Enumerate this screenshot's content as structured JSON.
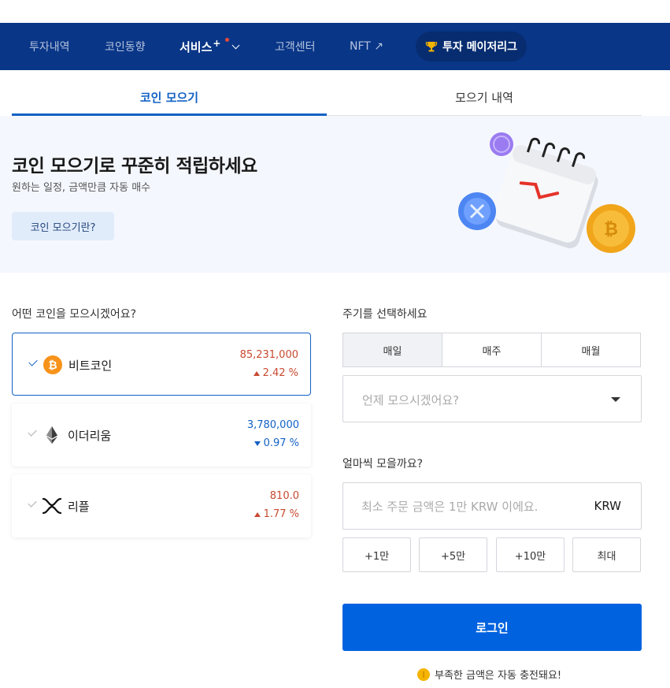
{
  "nav": {
    "items": [
      {
        "label": "투자내역"
      },
      {
        "label": "코인동향"
      },
      {
        "label": "서비스",
        "sup": "+"
      },
      {
        "label": "고객센터"
      },
      {
        "label": "NFT ↗"
      }
    ],
    "league": "투자 메이저리그"
  },
  "tabs": [
    {
      "label": "코인 모으기",
      "active": true
    },
    {
      "label": "모으기 내역",
      "active": false
    }
  ],
  "hero": {
    "title": "코인 모으기로 꾸준히 적립하세요",
    "subtitle": "원하는 일정, 금액만큼 자동 매수",
    "button": "코인 모으기란?"
  },
  "coin_section": {
    "question": "어떤 코인을 모으시겠어요?",
    "coins": [
      {
        "name": "비트코인",
        "price": "85,231,000",
        "change": "2.42 %",
        "direction": "up",
        "selected": true,
        "icon": "bitcoin-icon"
      },
      {
        "name": "이더리움",
        "price": "3,780,000",
        "change": "0.97 %",
        "direction": "down",
        "selected": false,
        "icon": "ethereum-icon"
      },
      {
        "name": "리플",
        "price": "810.0",
        "change": "1.77 %",
        "direction": "up",
        "selected": false,
        "icon": "xrp-icon"
      }
    ]
  },
  "period_section": {
    "question": "주기를 선택하세요",
    "options": [
      "매일",
      "매주",
      "매월"
    ],
    "selected": "매일",
    "select_placeholder": "언제 모으시겠어요?"
  },
  "amount_section": {
    "question": "얼마씩 모을까요?",
    "placeholder": "최소 주문 금액은 1만 KRW 이에요.",
    "unit": "KRW",
    "quick": [
      "+1만",
      "+5만",
      "+10만",
      "최대"
    ]
  },
  "login_label": "로그인",
  "notice": "부족한 금액은 자동 충전돼요!",
  "colors": {
    "nav_bg": "#093687",
    "accent": "#1261c4",
    "primary_button": "#0062df",
    "up": "#c84a31",
    "down": "#1261c4"
  }
}
